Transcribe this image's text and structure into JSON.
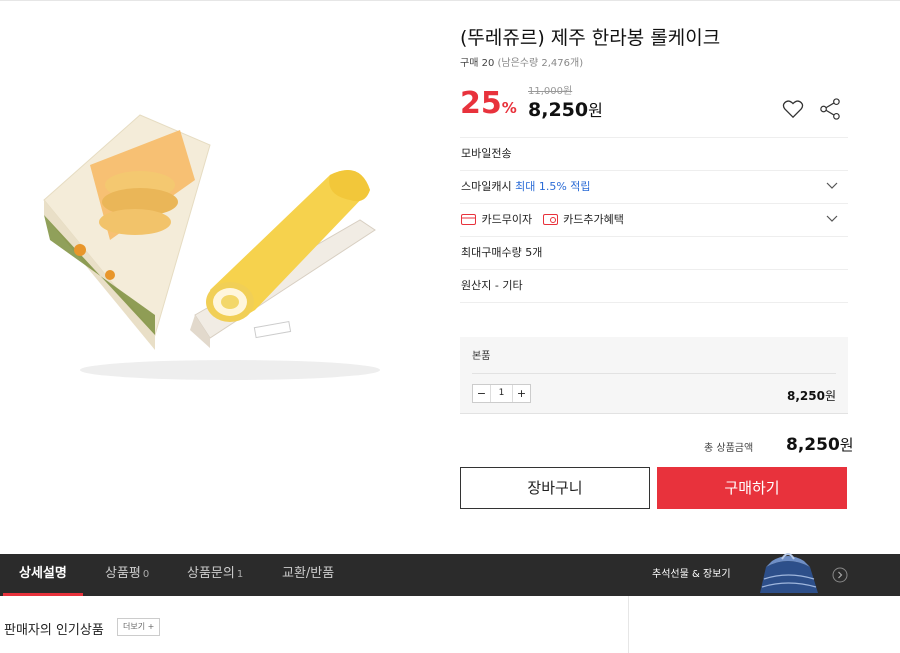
{
  "product": {
    "title": "(뚜레쥬르) 제주 한라봉 롤케이크",
    "purchase_count": "구매 20",
    "remaining": "(남은수량 2,476개)",
    "image_alt": "한라봉 롤케이크 product photo"
  },
  "price": {
    "discount": "25",
    "discount_unit": "%",
    "original": "11,000원",
    "sale": "8,250",
    "sale_unit": "원"
  },
  "icons": {
    "heart": "heart-icon",
    "share": "share-icon",
    "chevron": "chevron-down-icon",
    "card": "card-icon"
  },
  "info_rows": {
    "delivery": "모바일전송",
    "smilecash_label": "스마일캐시",
    "smilecash_benefit": "최대 1.5% 적립",
    "card_installment": "카드무이자",
    "card_benefit": "카드추가혜택",
    "max_purchase": "최대구매수량 5개",
    "origin": "원산지 - 기타"
  },
  "option": {
    "name": "본품",
    "minus": "−",
    "quantity": "1",
    "plus": "+",
    "price": "8,250",
    "price_unit": "원"
  },
  "total": {
    "label": "총 상품금액",
    "price": "8,250",
    "unit": "원"
  },
  "buttons": {
    "cart": "장바구니",
    "buy": "구매하기",
    "more": "더보기 +"
  },
  "tabs": [
    {
      "label": "상세설명",
      "count": ""
    },
    {
      "label": "상품평",
      "count": "0"
    },
    {
      "label": "상품문의",
      "count": "1"
    },
    {
      "label": "교환/반품",
      "count": ""
    }
  ],
  "promo": {
    "text": "추석선물 & 장보기"
  },
  "section": {
    "popular_title": "판매자의 인기상품"
  },
  "colors": {
    "accent_red": "#e8323c",
    "tabbar_bg": "#2b2b2b",
    "link_blue": "#2a6bd6"
  }
}
